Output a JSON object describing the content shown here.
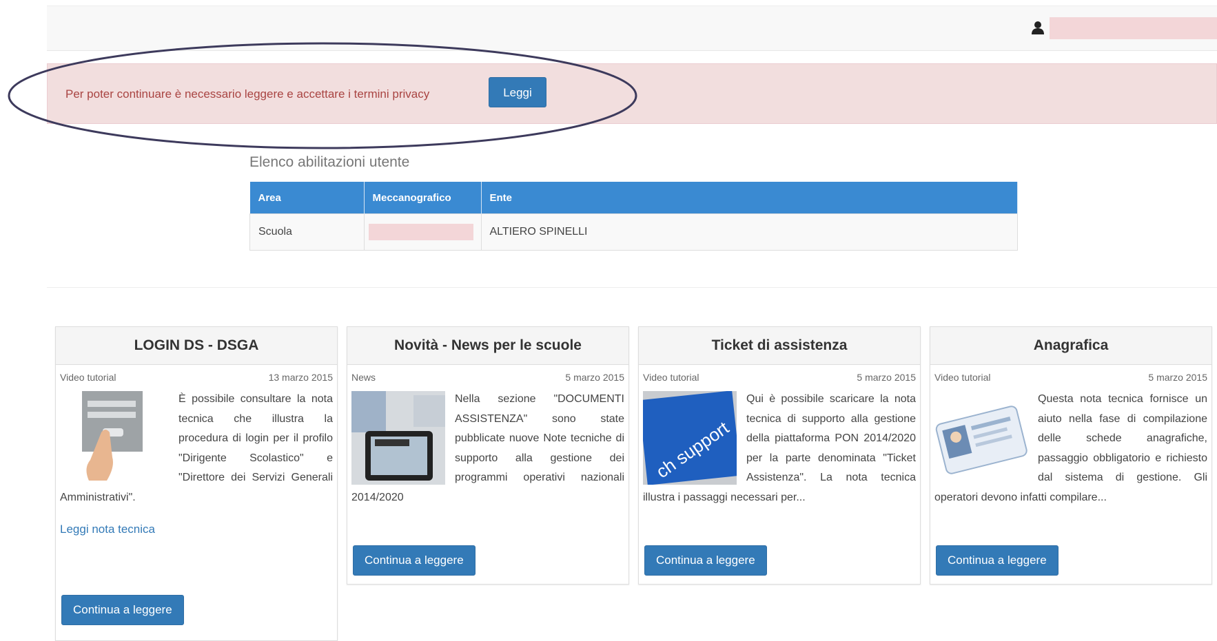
{
  "header": {
    "user_icon": "user-icon"
  },
  "alert": {
    "message": "Per poter continuare è necessario leggere e accettare i termini privacy",
    "button_label": "Leggi"
  },
  "abilitazioni": {
    "title": "Elenco abilitazioni utente",
    "columns": [
      "Area",
      "Meccanografico",
      "Ente"
    ],
    "rows": [
      {
        "area": "Scuola",
        "ente": "ALTIERO SPINELLI"
      }
    ]
  },
  "cards": [
    {
      "title": "LOGIN DS - DSGA",
      "category": "Video tutorial",
      "date": "13 marzo 2015",
      "text": "È possibile consultare la nota tecnica che illustra la procedura di login per il profilo \"Dirigente Scolastico\" e \"Direttore dei Servizi Generali Amministrativi\".",
      "link": "Leggi nota tecnica",
      "button": "Continua a leggere",
      "image_icon": "login-screen-hand-icon"
    },
    {
      "title": "Novità - News per le scuole",
      "category": "News",
      "date": "5 marzo 2015",
      "text": "Nella sezione \"DOCUMENTI ASSISTENZA\" sono state pubblicate nuove Note tecniche di supporto alla gestione dei programmi operativi nazionali 2014/2020",
      "button": "Continua a leggere",
      "image_icon": "newspapers-tablet-icon"
    },
    {
      "title": "Ticket di assistenza",
      "category": "Video tutorial",
      "date": "5 marzo 2015",
      "text": "Qui è possibile scaricare la nota tecnica di supporto alla gestione della piattaforma PON 2014/2020 per la parte denominata \"Ticket Assistenza\". La nota tecnica illustra i passaggi necessari per...",
      "button": "Continua a leggere",
      "image_icon": "tech-support-key-icon",
      "image_text": "ch support"
    },
    {
      "title": "Anagrafica",
      "category": "Video tutorial",
      "date": "5 marzo 2015",
      "text": "Questa nota tecnica fornisce un aiuto nella fase di compilazione delle schede anagrafiche, passaggio obbligatorio e richiesto dal sistema di gestione. Gli operatori devono infatti compilare...",
      "button": "Continua a leggere",
      "image_icon": "id-card-icon"
    }
  ],
  "colors": {
    "primary": "#337ab7",
    "alert_bg": "#f2dede",
    "alert_text": "#a94442",
    "table_header": "#3a8ad2"
  }
}
